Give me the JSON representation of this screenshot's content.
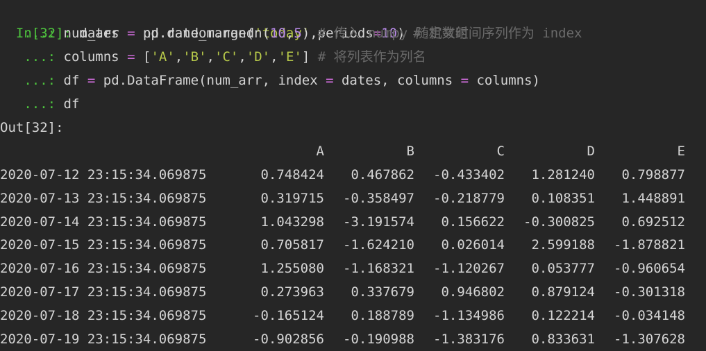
{
  "input": {
    "prompt": "In[32]:",
    "cont_prompt": "...:",
    "lines": [
      {
        "var": "dates",
        "op": "=",
        "code_a": "pd.date_range(",
        "str1": "'today'",
        "code_b": ",periods",
        "op2": "=",
        "num": "10",
        "code_c": ")",
        "comment": "# 定义时间序列作为 index"
      },
      {
        "var": "num_arr",
        "op": "=",
        "code_a": "np.random.randn(",
        "num1": "10",
        "code_b": ",",
        "num2": "5",
        "code_c": ")",
        "comment": "# 传入 numpy 随机数组"
      },
      {
        "var": "columns",
        "op": "=",
        "code_a": "[",
        "s1": "'A'",
        "s2": "'B'",
        "s3": "'C'",
        "s4": "'D'",
        "s5": "'E'",
        "code_c": "]",
        "comment": "# 将列表作为列名"
      },
      {
        "var": "df",
        "op": "=",
        "code_a": "pd.DataFrame(num_arr, index ",
        "op2": "=",
        "code_b": " dates, columns ",
        "op3": "=",
        "code_c": " columns)"
      },
      {
        "var": "df"
      }
    ]
  },
  "output": {
    "prompt": "Out[32]:",
    "columns": [
      "A",
      "B",
      "C",
      "D",
      "E"
    ],
    "rows": [
      {
        "index": "2020-07-12 23:15:34.069875",
        "values": [
          "0.748424",
          "0.467862",
          "-0.433402",
          "1.281240",
          "0.798877"
        ]
      },
      {
        "index": "2020-07-13 23:15:34.069875",
        "values": [
          "0.319715",
          "-0.358497",
          "-0.218779",
          "0.108351",
          "1.448891"
        ]
      },
      {
        "index": "2020-07-14 23:15:34.069875",
        "values": [
          "1.043298",
          "-3.191574",
          "0.156622",
          "-0.300825",
          "0.692512"
        ]
      },
      {
        "index": "2020-07-15 23:15:34.069875",
        "values": [
          "0.705817",
          "-1.624210",
          "0.026014",
          "2.599188",
          "-1.878821"
        ]
      },
      {
        "index": "2020-07-16 23:15:34.069875",
        "values": [
          "1.255080",
          "-1.168321",
          "-1.120267",
          "0.053777",
          "-0.960654"
        ]
      },
      {
        "index": "2020-07-17 23:15:34.069875",
        "values": [
          "0.273963",
          "0.337679",
          "0.946802",
          "0.879124",
          "-0.301318"
        ]
      },
      {
        "index": "2020-07-18 23:15:34.069875",
        "values": [
          "-0.165124",
          "0.188789",
          "-1.134986",
          "0.122214",
          "-0.034148"
        ]
      },
      {
        "index": "2020-07-19 23:15:34.069875",
        "values": [
          "-0.902856",
          "-0.190988",
          "-1.383176",
          "0.833631",
          "-1.307628"
        ]
      }
    ]
  }
}
